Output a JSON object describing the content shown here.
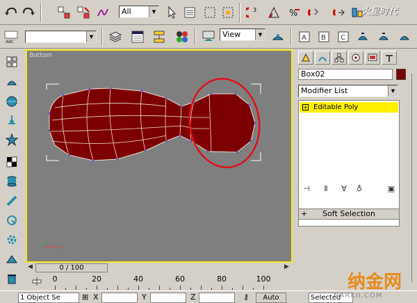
{
  "toolbar_top": {
    "selection_filter": "All",
    "watermark_text": "火星时代",
    "icons": [
      "undo-icon",
      "redo-icon",
      "select-link-icon",
      "unlink-icon",
      "bind-space-warp-icon",
      "select-object-icon",
      "select-by-name-icon",
      "rect-region-icon",
      "crossing-icon",
      "select-move-icon",
      "select-rotate-icon",
      "select-scale-icon",
      "snap-3d-icon",
      "angle-snap-icon",
      "percent-snap-icon",
      "spinner-snap-icon",
      "named-selection-icon",
      "mirror-icon",
      "align-icon"
    ]
  },
  "toolbar_second": {
    "named_selection": "",
    "reference_coord": "View",
    "icons": [
      "named-set-icon",
      "layers-icon",
      "curve-editor-icon",
      "schematic-icon",
      "material-editor-icon",
      "render-scene-icon",
      "quick-render-icon",
      "render-type-icon",
      "render-last-icon"
    ]
  },
  "viewport": {
    "label": "Bottom",
    "mesh_color": "#7d0000",
    "circle_color": "#e0101a",
    "border_color": "#f5e61e"
  },
  "timeline": {
    "frame_display": "0 / 100",
    "ruler_labels": [
      "0",
      "20",
      "40",
      "60",
      "80",
      "100"
    ]
  },
  "status": {
    "selection_text": "1 Object Se",
    "x_label": "X",
    "y_label": "Y",
    "z_label": "Z",
    "auto_key": "Auto Key",
    "selected": "Selected"
  },
  "command_panel": {
    "object_name": "Box02",
    "object_color": "#7d0000",
    "modifier_list": "Modifier List",
    "stack_items": [
      "Editable Poly"
    ],
    "rollout_soft_selection": "Soft Selection",
    "plus": "+"
  },
  "watermarks": {
    "bottom_cn": "纳金网",
    "bottom_url": "NARKII.COM"
  }
}
